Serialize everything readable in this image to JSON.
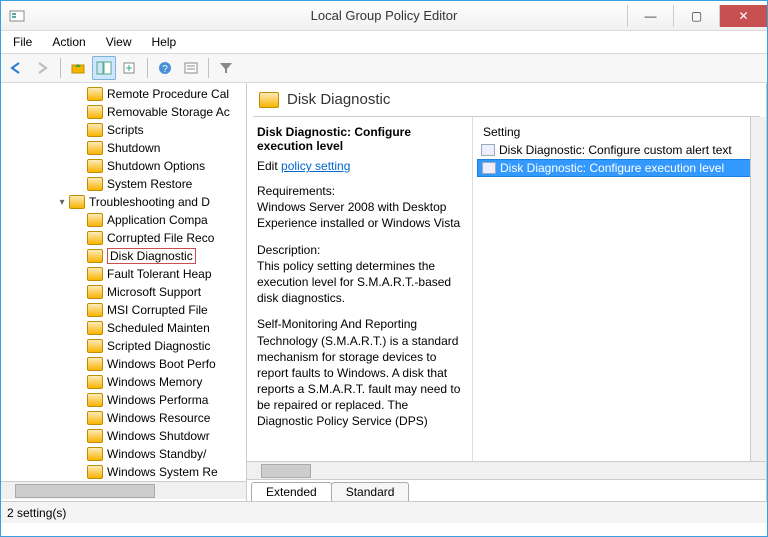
{
  "window": {
    "title": "Local Group Policy Editor",
    "min": "—",
    "max": "▢",
    "close": "✕"
  },
  "menu": [
    "File",
    "Action",
    "View",
    "Help"
  ],
  "toolbar": {
    "back": "←",
    "forward": "→",
    "up": "⬆",
    "show": "▦",
    "export": "⎙",
    "refresh": "⟳",
    "help": "?",
    "props": "▤",
    "filter": "▼"
  },
  "tree": [
    {
      "indent": 4,
      "label": "Remote Procedure Cal"
    },
    {
      "indent": 4,
      "label": "Removable Storage Ac"
    },
    {
      "indent": 4,
      "label": "Scripts"
    },
    {
      "indent": 4,
      "label": "Shutdown"
    },
    {
      "indent": 4,
      "label": "Shutdown Options"
    },
    {
      "indent": 4,
      "label": "System Restore"
    },
    {
      "indent": 3,
      "label": "Troubleshooting and D",
      "expander": "▾"
    },
    {
      "indent": 4,
      "label": "Application Compa"
    },
    {
      "indent": 4,
      "label": "Corrupted File Reco"
    },
    {
      "indent": 4,
      "label": "Disk Diagnostic",
      "selected": true
    },
    {
      "indent": 4,
      "label": "Fault Tolerant Heap"
    },
    {
      "indent": 4,
      "label": "Microsoft Support"
    },
    {
      "indent": 4,
      "label": "MSI Corrupted File"
    },
    {
      "indent": 4,
      "label": "Scheduled Mainten"
    },
    {
      "indent": 4,
      "label": "Scripted Diagnostic"
    },
    {
      "indent": 4,
      "label": "Windows Boot Perfo"
    },
    {
      "indent": 4,
      "label": "Windows Memory"
    },
    {
      "indent": 4,
      "label": "Windows Performa"
    },
    {
      "indent": 4,
      "label": "Windows Resource"
    },
    {
      "indent": 4,
      "label": "Windows Shutdowr"
    },
    {
      "indent": 4,
      "label": "Windows Standby/"
    },
    {
      "indent": 4,
      "label": "Windows System Re"
    }
  ],
  "content": {
    "heading": "Disk Diagnostic",
    "policy_title": "Disk Diagnostic: Configure execution level",
    "edit_label": "Edit",
    "policy_link": "policy setting",
    "req_label": "Requirements:",
    "req_text": "Windows Server 2008 with Desktop Experience installed or Windows Vista",
    "desc_label": "Description:",
    "desc_text": "This policy setting determines the execution level for S.M.A.R.T.-based disk diagnostics.",
    "desc_body": "Self-Monitoring And Reporting Technology (S.M.A.R.T.) is a standard mechanism for storage devices to report faults to Windows. A disk that reports a S.M.A.R.T. fault may need to be repaired or replaced. The Diagnostic Policy Service (DPS)"
  },
  "list": {
    "header": "Setting",
    "rows": [
      {
        "label": "Disk Diagnostic: Configure custom alert text",
        "selected": false
      },
      {
        "label": "Disk Diagnostic: Configure execution level",
        "selected": true
      }
    ]
  },
  "tabs": {
    "extended": "Extended",
    "standard": "Standard"
  },
  "status": "2 setting(s)"
}
